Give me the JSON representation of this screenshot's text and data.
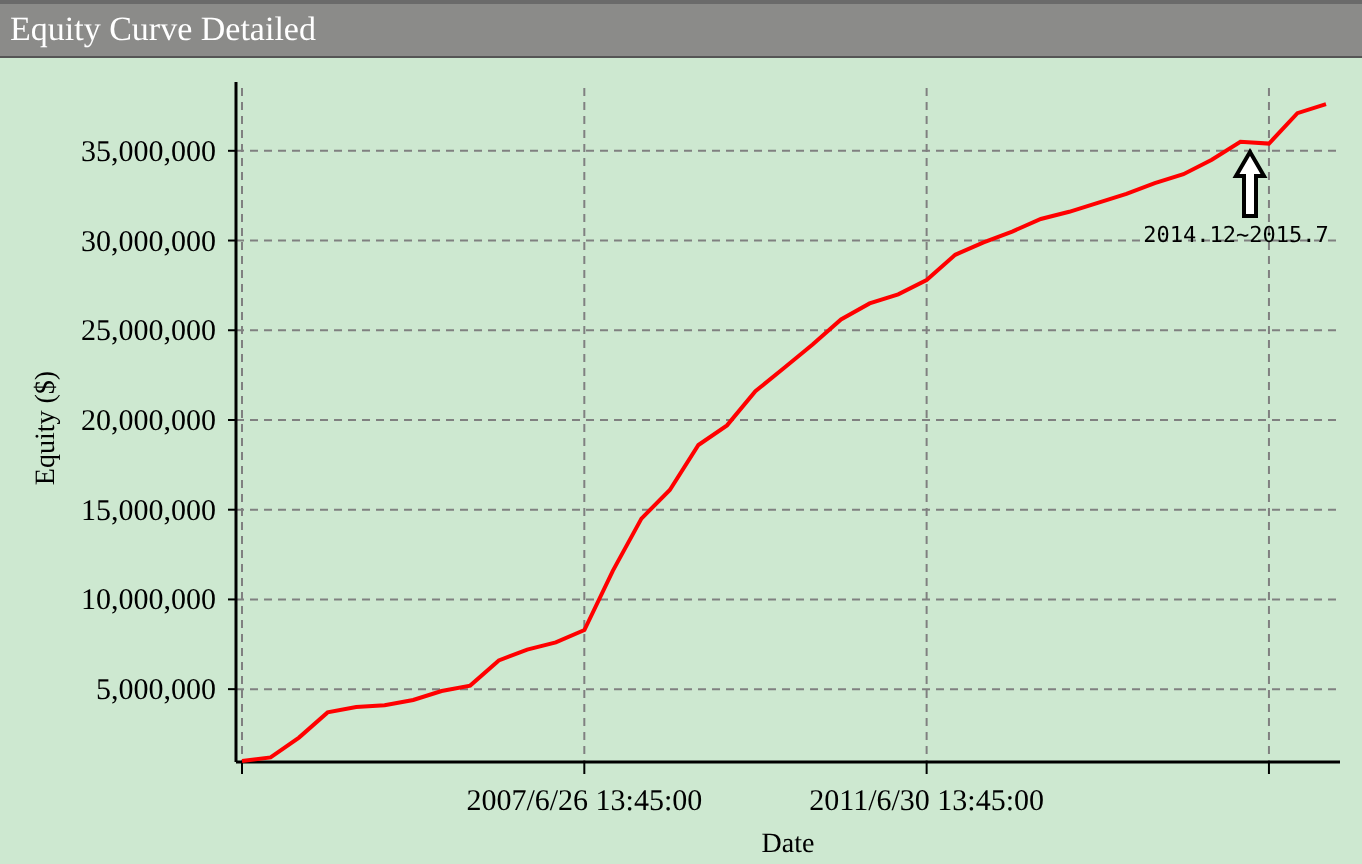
{
  "window": {
    "title": "Equity Curve Detailed"
  },
  "chart": {
    "chart_data": {
      "type": "line",
      "xlabel": "Date",
      "ylabel": "Equity ($)",
      "categories": [
        null,
        null,
        null,
        null,
        null,
        null,
        null,
        null,
        null,
        null,
        null,
        null,
        "2007/6/26 13:45:00",
        null,
        null,
        null,
        null,
        null,
        null,
        null,
        null,
        null,
        null,
        null,
        "2011/6/30 13:45:00",
        null,
        null,
        null,
        null,
        null,
        null,
        null,
        null,
        null,
        null,
        null,
        null,
        null,
        null
      ],
      "series": [
        {
          "color": "#ff0000",
          "values": [
            1000000,
            1200000,
            2300000,
            3700000,
            4000000,
            4100000,
            4400000,
            4900000,
            5200000,
            6600000,
            7200000,
            7600000,
            8300000,
            11600000,
            14500000,
            16100000,
            18600000,
            19700000,
            21600000,
            22900000,
            24200000,
            25600000,
            26500000,
            27000000,
            27800000,
            29200000,
            29900000,
            30500000,
            31200000,
            31600000,
            32100000,
            32600000,
            33200000,
            33700000,
            34500000,
            35500000,
            35400000,
            37100000,
            37600000
          ]
        }
      ],
      "ylim": [
        940000,
        38500000
      ],
      "grid": true,
      "yticks": [
        {
          "value": 5000000,
          "label": "5,000,000"
        },
        {
          "value": 10000000,
          "label": "10,000,000"
        },
        {
          "value": 15000000,
          "label": "15,000,000"
        },
        {
          "value": 20000000,
          "label": "20,000,000"
        },
        {
          "value": 25000000,
          "label": "25,000,000"
        },
        {
          "value": 30000000,
          "label": "30,000,000"
        },
        {
          "value": 35000000,
          "label": "35,000,000"
        }
      ],
      "annotations": [
        "2014.12~2015.7"
      ]
    }
  }
}
